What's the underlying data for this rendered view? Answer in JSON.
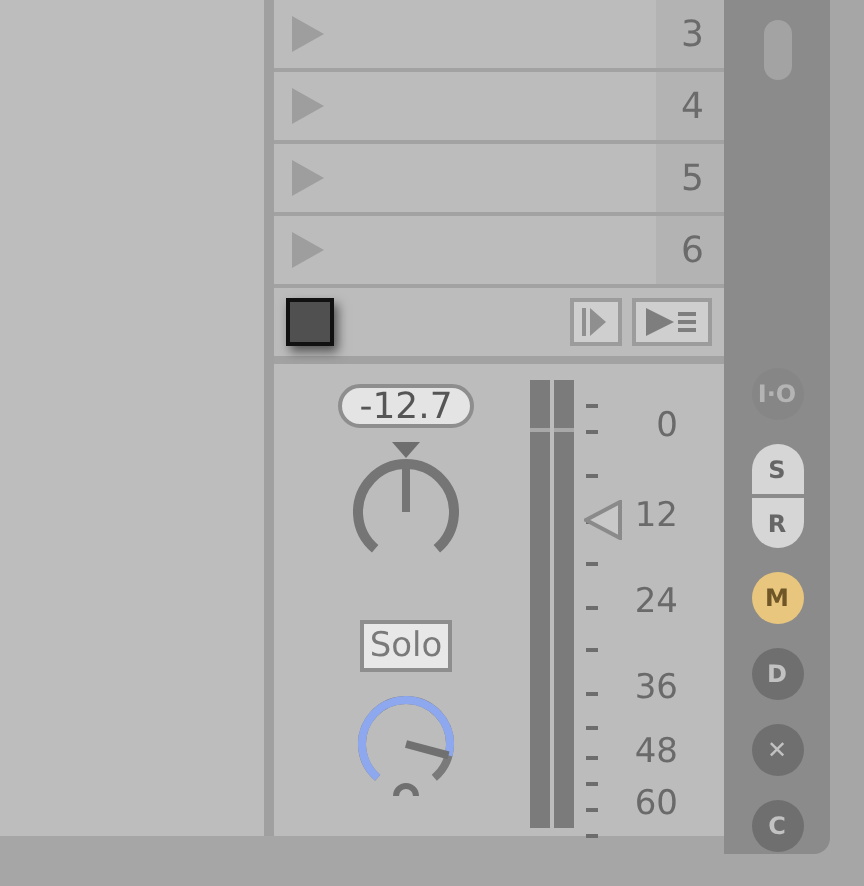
{
  "clip_slots": [
    {
      "number": "3"
    },
    {
      "number": "4"
    },
    {
      "number": "5"
    },
    {
      "number": "6"
    }
  ],
  "stop_row": {
    "buttons": [
      {
        "kind": "stop-clips"
      },
      {
        "kind": "play-list"
      }
    ]
  },
  "mixer": {
    "volume_readout": "-12.7",
    "solo_label": "Solo",
    "meter_scale": [
      "0",
      "12",
      "24",
      "36",
      "48",
      "60"
    ]
  },
  "side_buttons": [
    {
      "label": "I·O",
      "kind": "circle",
      "disabled": true,
      "on": false
    },
    {
      "label": "S",
      "kind": "top",
      "disabled": false,
      "on": false
    },
    {
      "label": "R",
      "kind": "bottom",
      "disabled": false,
      "on": false
    },
    {
      "label": "M",
      "kind": "circle",
      "disabled": false,
      "on": true
    },
    {
      "label": "D",
      "kind": "circle",
      "disabled": false,
      "on": false
    },
    {
      "label": "✕",
      "kind": "circle",
      "disabled": false,
      "on": false
    },
    {
      "label": "C",
      "kind": "circle",
      "disabled": false,
      "on": false
    }
  ]
}
